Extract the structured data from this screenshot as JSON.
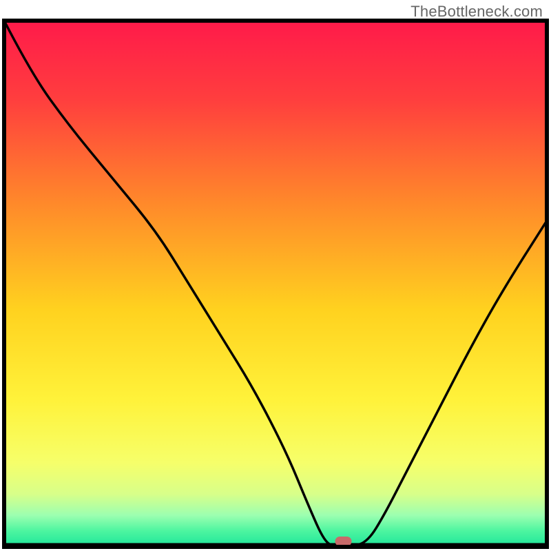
{
  "watermark": "TheBottleneck.com",
  "chart_data": {
    "type": "line",
    "title": "",
    "xlabel": "",
    "ylabel": "",
    "xlim": [
      0,
      100
    ],
    "ylim": [
      0,
      100
    ],
    "grid": false,
    "legend": false,
    "series": [
      {
        "name": "bottleneck-curve",
        "x": [
          0,
          5,
          12,
          20,
          28,
          34,
          40,
          46,
          52,
          56,
          59,
          61,
          64,
          67,
          70,
          74,
          80,
          86,
          92,
          100
        ],
        "y": [
          100,
          90,
          80,
          70,
          60,
          50,
          40,
          30,
          18,
          8,
          1,
          0,
          0,
          1,
          6,
          14,
          26,
          38,
          49,
          62
        ]
      }
    ],
    "marker": {
      "name": "optimal-point",
      "x": 62.5,
      "y": 0,
      "color": "#c86a6a"
    },
    "background_gradient": {
      "stops": [
        {
          "offset": 0.0,
          "color": "#ff1a4a"
        },
        {
          "offset": 0.15,
          "color": "#ff3e3e"
        },
        {
          "offset": 0.35,
          "color": "#ff8a2a"
        },
        {
          "offset": 0.55,
          "color": "#ffd21f"
        },
        {
          "offset": 0.72,
          "color": "#fff23a"
        },
        {
          "offset": 0.84,
          "color": "#f6ff6a"
        },
        {
          "offset": 0.9,
          "color": "#d8ff8a"
        },
        {
          "offset": 0.94,
          "color": "#9cffb0"
        },
        {
          "offset": 0.97,
          "color": "#4cf5a0"
        },
        {
          "offset": 1.0,
          "color": "#1ee59a"
        }
      ]
    },
    "frame_color": "#000000",
    "line_color": "#000000",
    "baseline_color": "#000000"
  }
}
